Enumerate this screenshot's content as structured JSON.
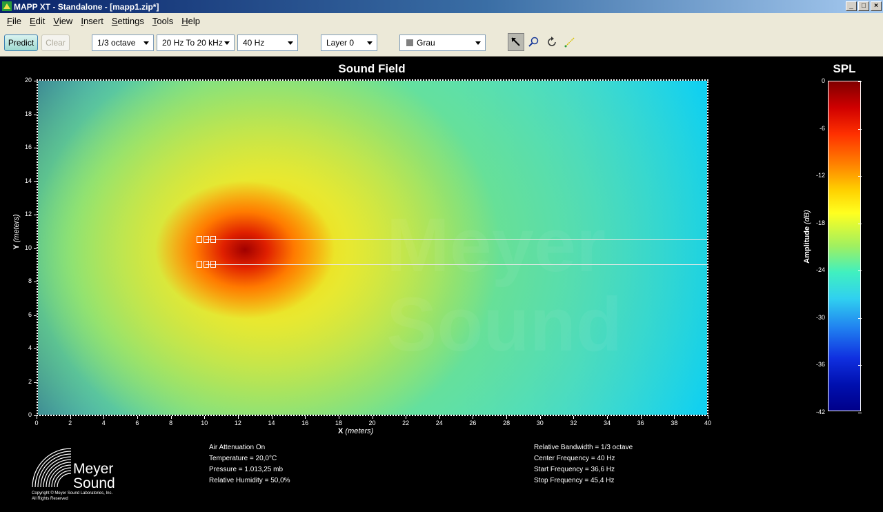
{
  "window": {
    "title": "MAPP XT - Standalone - [mapp1.zip*]",
    "controls": [
      "_",
      "□",
      "×"
    ]
  },
  "menu": [
    "File",
    "Edit",
    "View",
    "Insert",
    "Settings",
    "Tools",
    "Help"
  ],
  "toolbar": {
    "predict_label": "Predict",
    "clear_label": "Clear",
    "bandwidth": "1/3 octave",
    "freq_range": "20 Hz To 20 kHz",
    "frequency": "40 Hz",
    "layer": "Layer 0",
    "color_scheme": "Grau"
  },
  "plot": {
    "title": "Sound Field",
    "x_axis": {
      "name": "X",
      "unit": "(meters)",
      "ticks": [
        "0",
        "2",
        "4",
        "6",
        "8",
        "10",
        "12",
        "14",
        "16",
        "18",
        "20",
        "22",
        "24",
        "26",
        "28",
        "30",
        "32",
        "34",
        "36",
        "38",
        "40"
      ]
    },
    "y_axis": {
      "name": "Y",
      "unit": "(meters)",
      "ticks": [
        "20",
        "18",
        "16",
        "14",
        "12",
        "10",
        "8",
        "6",
        "4",
        "2",
        "0"
      ]
    },
    "watermark_line1": "Meyer",
    "watermark_line2": "Sound"
  },
  "colorbar": {
    "title": "SPL",
    "axis_label": "Amplitude",
    "axis_unit": "(dB)",
    "ticks": [
      "0",
      "-6",
      "-12",
      "-18",
      "-24",
      "-30",
      "-36",
      "-42"
    ]
  },
  "footer": {
    "conditions": [
      "Air Attenuation On",
      "Temperature = 20,0°C",
      "Pressure = 1.013,25  mb",
      "Relative Humidity = 50,0%"
    ],
    "analysis": [
      "Relative Bandwidth = 1/3 octave",
      "Center Frequency = 40 Hz",
      "Start Frequency = 36,6 Hz",
      "Stop Frequency = 45,4 Hz"
    ],
    "logo_line1": "Meyer",
    "logo_line2": "Sound",
    "copyright_line1": "Copyright © Meyer Sound Laboratories, Inc.",
    "copyright_line2": "All Rights Reserved"
  }
}
